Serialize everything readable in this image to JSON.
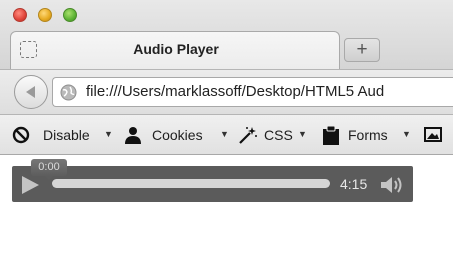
{
  "window": {
    "controls": [
      "close",
      "minimize",
      "zoom"
    ]
  },
  "tab": {
    "title": "Audio Player",
    "new_tab_label": "+"
  },
  "navbar": {
    "url": "file:///Users/marklassoff/Desktop/HTML5 Aud"
  },
  "bookmarks": {
    "items": [
      {
        "label": "Disable",
        "icon": "no-entry-icon"
      },
      {
        "label": "Cookies",
        "icon": "person-icon"
      },
      {
        "label": "CSS",
        "icon": "magic-wand-icon"
      },
      {
        "label": "Forms",
        "icon": "clipboard-icon"
      },
      {
        "label": "",
        "icon": "image-icon"
      }
    ],
    "caret": "▼"
  },
  "audio_player": {
    "current_time": "0:00",
    "duration": "4:15",
    "progress": 0
  }
}
